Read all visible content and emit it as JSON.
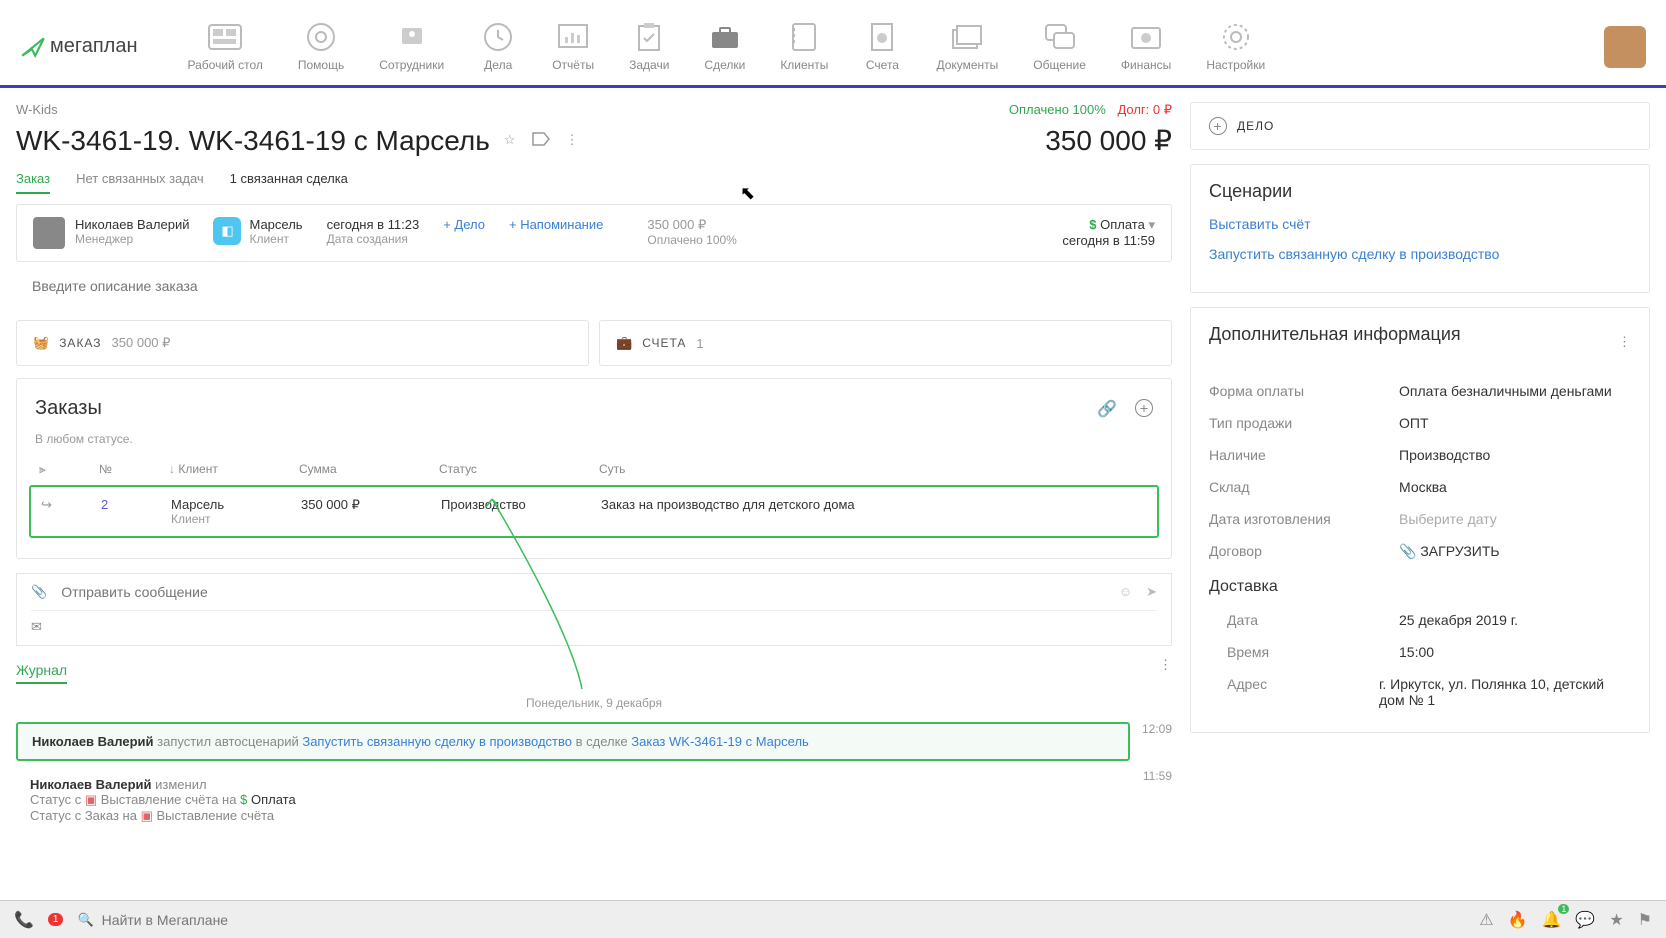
{
  "nav": {
    "logo_text": "мегаплан",
    "items": [
      {
        "label": "Рабочий стол"
      },
      {
        "label": "Помощь"
      },
      {
        "label": "Сотрудники"
      },
      {
        "label": "Дела"
      },
      {
        "label": "Отчёты"
      },
      {
        "label": "Задачи"
      },
      {
        "label": "Сделки"
      },
      {
        "label": "Клиенты"
      },
      {
        "label": "Счета"
      },
      {
        "label": "Документы"
      },
      {
        "label": "Общение"
      },
      {
        "label": "Финансы"
      },
      {
        "label": "Настройки"
      }
    ]
  },
  "breadcrumb": "W-Kids",
  "paid": "Оплачено 100%",
  "debt": "Долг: 0 ₽",
  "title": "WK-3461-19. WK-3461-19 с Марсель",
  "amount": "350 000 ₽",
  "tabs": {
    "order": "Заказ",
    "no_tasks": "Нет связанных задач",
    "deals": "1 связанная сделка"
  },
  "header": {
    "manager": {
      "name": "Николаев Валерий",
      "role": "Менеджер"
    },
    "client": {
      "name": "Марсель",
      "role": "Клиент"
    },
    "created": {
      "value": "сегодня в 11:23",
      "label": "Дата создания"
    },
    "action_deal": "+ Дело",
    "action_remind": "+ Напоминание",
    "total": {
      "value": "350 000 ₽",
      "sub": "Оплачено 100%"
    },
    "status": {
      "label": "Оплата",
      "sub": "сегодня в 11:59"
    },
    "desc_placeholder": "Введите описание заказа"
  },
  "tiles": {
    "order": {
      "label": "ЗАКАЗ",
      "value": "350 000 ₽"
    },
    "bills": {
      "label": "СЧЕТА",
      "value": "1"
    }
  },
  "orders": {
    "title": "Заказы",
    "filter": "В любом статусе.",
    "cols": {
      "num": "№",
      "client": "Клиент",
      "sum": "Сумма",
      "status": "Статус",
      "desc": "Суть"
    },
    "row": {
      "num": "2",
      "client": "Марсель",
      "client_sub": "Клиент",
      "sum": "350 000 ₽",
      "status": "Производство",
      "desc": "Заказ на производство для детского дома"
    }
  },
  "msg": {
    "placeholder": "Отправить сообщение"
  },
  "journal": {
    "tab": "Журнал",
    "date": "Понедельник, 9 декабря",
    "e1": {
      "name": "Николаев Валерий",
      "action": "запустил автосценарий",
      "link1": "Запустить связанную сделку в производство",
      "mid": "в сделке",
      "link2": "Заказ WK-3461-19 с Марсель",
      "time": "12:09"
    },
    "e2": {
      "name": "Николаев Валерий",
      "action": "изменил",
      "l1a": "Статус  с",
      "l1b": "Выставление счёта",
      "l1c": "на",
      "l1d": "Оплата",
      "l2a": "Статус  с Заказ на",
      "l2b": "Выставление счёта",
      "time": "11:59"
    }
  },
  "side": {
    "dealbtn": "ДЕЛО",
    "scen": {
      "title": "Сценарии",
      "link1": "Выставить счёт",
      "link2": "Запустить связанную сделку в производство"
    },
    "info": {
      "title": "Дополнительная информация",
      "rows": [
        {
          "k": "Форма оплаты",
          "v": "Оплата безналичными деньгами"
        },
        {
          "k": "Тип продажи",
          "v": "ОПТ"
        },
        {
          "k": "Наличие",
          "v": "Производство"
        },
        {
          "k": "Склад",
          "v": "Москва"
        },
        {
          "k": "Дата изготовления",
          "v": "Выберите дату",
          "ph": true
        },
        {
          "k": "Договор",
          "v": "ЗАГРУЗИТЬ",
          "attach": true
        }
      ],
      "delivery": "Доставка",
      "drows": [
        {
          "k": "Дата",
          "v": "25 декабря 2019 г."
        },
        {
          "k": "Время",
          "v": "15:00"
        },
        {
          "k": "Адрес",
          "v": "г. Иркутск, ул. Полянка 10, детский дом № 1"
        }
      ]
    }
  },
  "bottom": {
    "search_ph": "Найти в Мегаплане",
    "call_badge": "1",
    "bell_badge": "1"
  }
}
